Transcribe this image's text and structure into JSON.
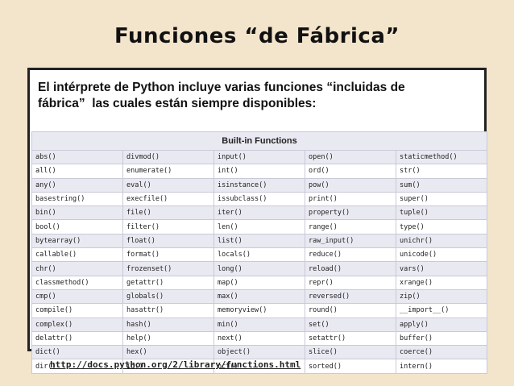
{
  "title": "Funciones “de Fábrica”",
  "intro": "El intérprete de Python incluye varias funciones “incluidas de\nfábrica”  las cuales están siempre disponibles:",
  "table": {
    "heading": "Built-in Functions",
    "rows": [
      [
        "abs()",
        "divmod()",
        "input()",
        "open()",
        "staticmethod()"
      ],
      [
        "all()",
        "enumerate()",
        "int()",
        "ord()",
        "str()"
      ],
      [
        "any()",
        "eval()",
        "isinstance()",
        "pow()",
        "sum()"
      ],
      [
        "basestring()",
        "execfile()",
        "issubclass()",
        "print()",
        "super()"
      ],
      [
        "bin()",
        "file()",
        "iter()",
        "property()",
        "tuple()"
      ],
      [
        "bool()",
        "filter()",
        "len()",
        "range()",
        "type()"
      ],
      [
        "bytearray()",
        "float()",
        "list()",
        "raw_input()",
        "unichr()"
      ],
      [
        "callable()",
        "format()",
        "locals()",
        "reduce()",
        "unicode()"
      ],
      [
        "chr()",
        "frozenset()",
        "long()",
        "reload()",
        "vars()"
      ],
      [
        "classmethod()",
        "getattr()",
        "map()",
        "repr()",
        "xrange()"
      ],
      [
        "cmp()",
        "globals()",
        "max()",
        "reversed()",
        "zip()"
      ],
      [
        "compile()",
        "hasattr()",
        "memoryview()",
        "round()",
        "__import__()"
      ],
      [
        "complex()",
        "hash()",
        "min()",
        "set()",
        "apply()"
      ],
      [
        "delattr()",
        "help()",
        "next()",
        "setattr()",
        "buffer()"
      ],
      [
        "dict()",
        "hex()",
        "object()",
        "slice()",
        "coerce()"
      ],
      [
        "dir()",
        "id()",
        "oct()",
        "sorted()",
        "intern()"
      ]
    ]
  },
  "url": "http://docs.python.org/2/library/functions.html"
}
